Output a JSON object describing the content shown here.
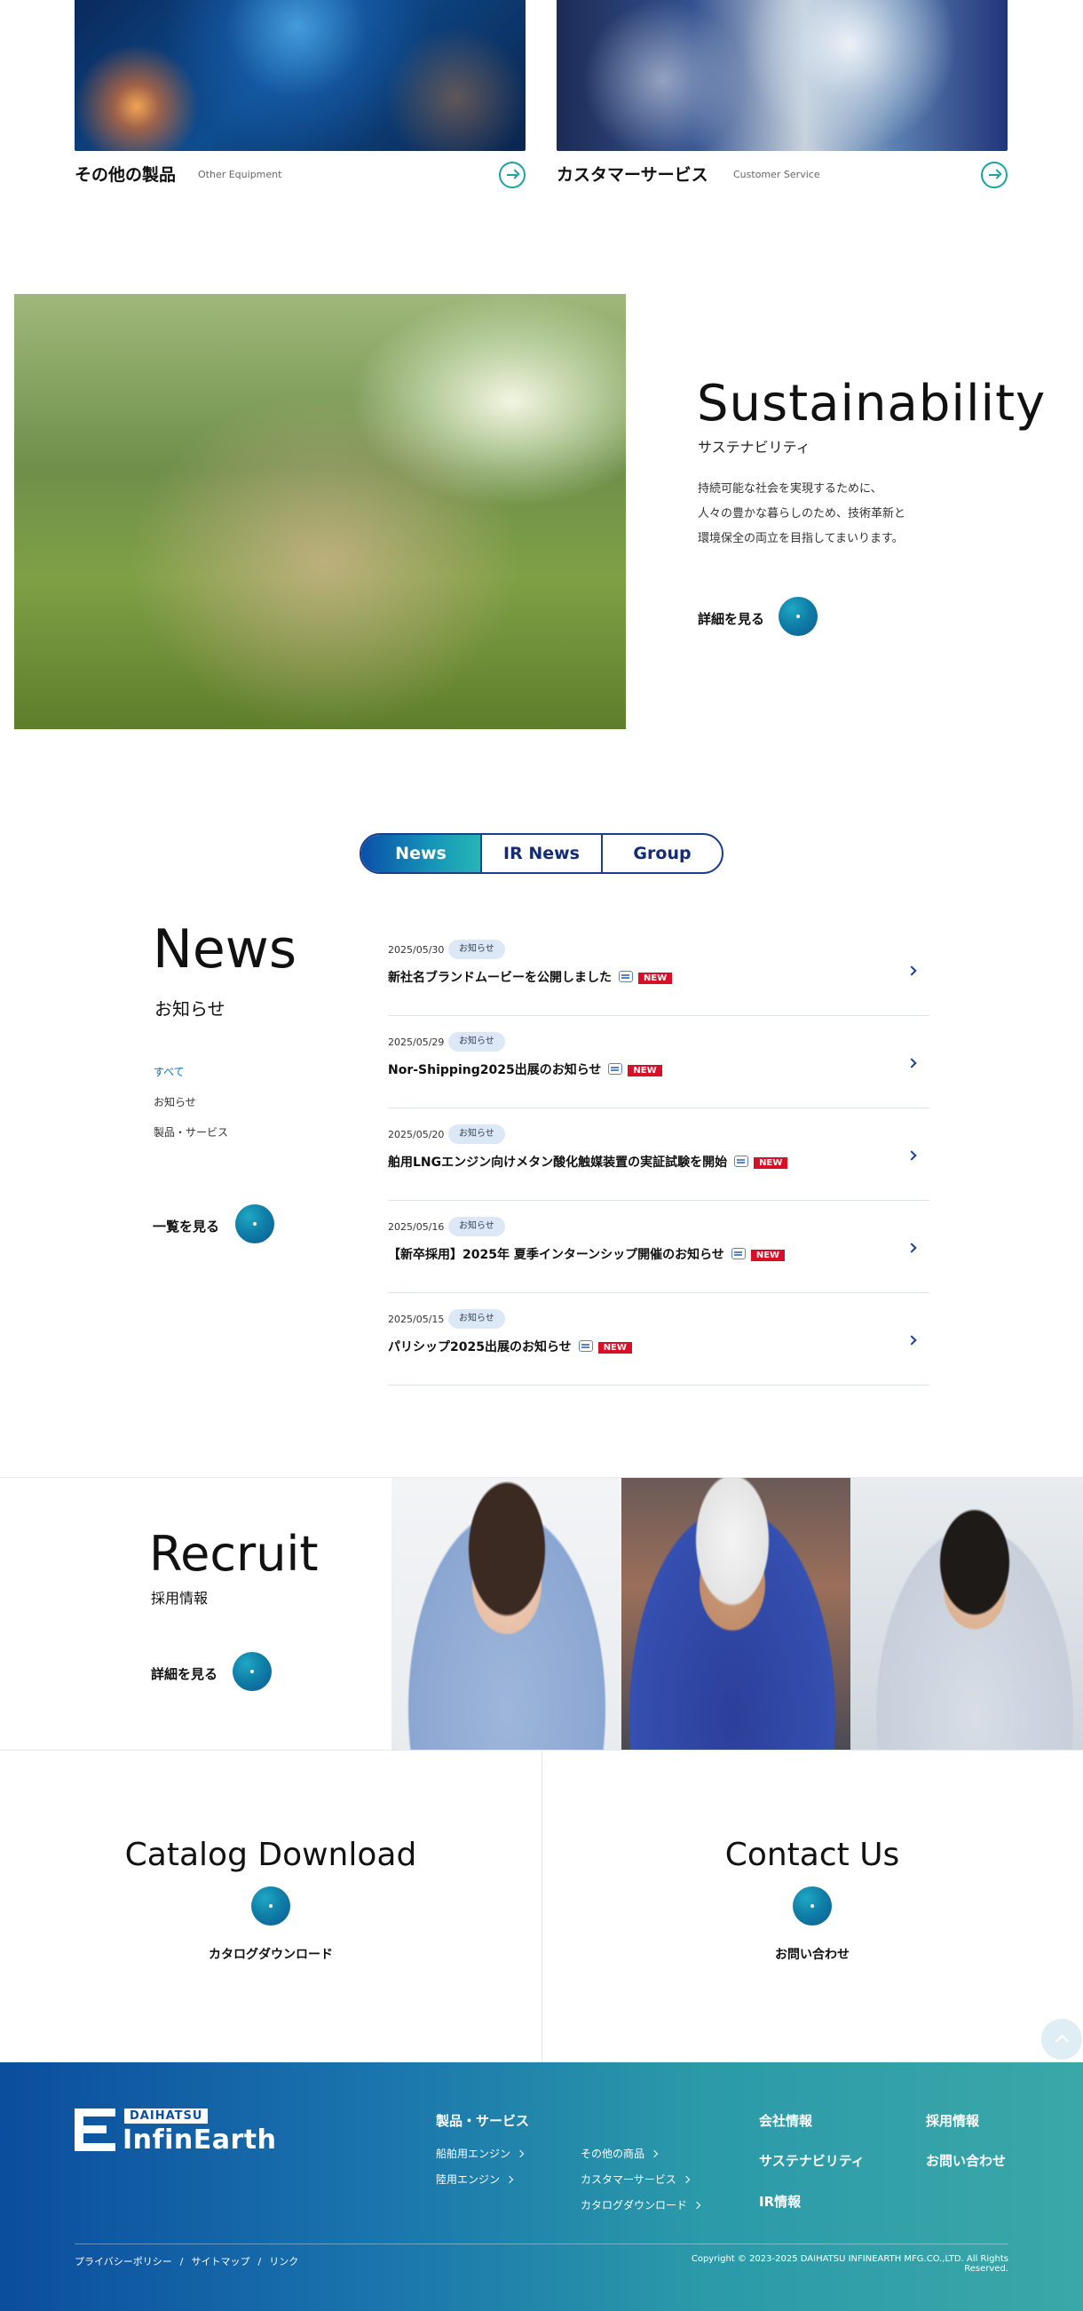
{
  "products": [
    {
      "title": "その他の製品",
      "subtitle": "Other Equipment"
    },
    {
      "title": "カスタマーサービス",
      "subtitle": "Customer Service"
    }
  ],
  "sustainability": {
    "heading": "Sustainability",
    "subheading": "サステナビリティ",
    "body_lines": [
      "持続可能な社会を実現するために、",
      "人々の豊かな暮らしのため、技術革新と",
      "環境保全の両立を目指してまいります。"
    ],
    "more_label": "詳細を見る"
  },
  "news_tabs": [
    {
      "label": "News",
      "active": true
    },
    {
      "label": "IR News",
      "active": false
    },
    {
      "label": "Group",
      "active": false
    }
  ],
  "news": {
    "heading": "News",
    "subheading": "お知らせ",
    "filters": [
      {
        "label": "すべて",
        "active": true
      },
      {
        "label": "お知らせ",
        "active": false
      },
      {
        "label": "製品・サービス",
        "active": false
      }
    ],
    "list_label": "一覧を見る",
    "new_badge": "NEW",
    "items": [
      {
        "date": "2025/05/30",
        "category": "お知らせ",
        "title": "新社名ブランドムービーを公開しました"
      },
      {
        "date": "2025/05/29",
        "category": "お知らせ",
        "title": "Nor-Shipping2025出展のお知らせ"
      },
      {
        "date": "2025/05/20",
        "category": "お知らせ",
        "title": "舶用LNGエンジン向けメタン酸化触媒装置の実証試験を開始"
      },
      {
        "date": "2025/05/16",
        "category": "お知らせ",
        "title": "【新卒採用】2025年 夏季インターンシップ開催のお知らせ"
      },
      {
        "date": "2025/05/15",
        "category": "お知らせ",
        "title": "パリシップ2025出展のお知らせ"
      }
    ]
  },
  "recruit": {
    "heading": "Recruit",
    "subheading": "採用情報",
    "more_label": "詳細を見る"
  },
  "catalog": {
    "heading": "Catalog Download",
    "subheading": "カタログダウンロード"
  },
  "contact": {
    "heading": "Contact Us",
    "subheading": "お問い合わせ"
  },
  "footer": {
    "logo_top": "DAIHATSU",
    "logo_name": "InfinEarth",
    "products_heading": "製品・サービス",
    "product_links_col1": [
      "船舶用エンジン",
      "陸用エンジン"
    ],
    "product_links_col2": [
      "その他の商品",
      "カスタマーサービス",
      "カタログダウンロード"
    ],
    "company_links": [
      "会社情報",
      "サステナビリティ",
      "IR情報"
    ],
    "other_links": [
      "採用情報",
      "お問い合わせ"
    ],
    "legal_links": [
      "プライバシーポリシー",
      "サイトマップ",
      "リンク"
    ],
    "copyright": "Copyright © 2023-2025 DAIHATSU INFINEARTH MFG.CO.,LTD. All Rights Reserved."
  },
  "colors": {
    "brand_navy": "#1a3f8f",
    "accent_teal": "#1aa3a3",
    "new_red": "#d90f2a",
    "footer_gradient_start": "#0b4d9e",
    "footer_gradient_end": "#3aa8a8"
  },
  "icons": {
    "card_arrow": "arrow-right-circle-icon",
    "news_chevron": "chevron-right-icon",
    "news_doc": "document-icon",
    "page_top": "chevron-up-icon"
  }
}
